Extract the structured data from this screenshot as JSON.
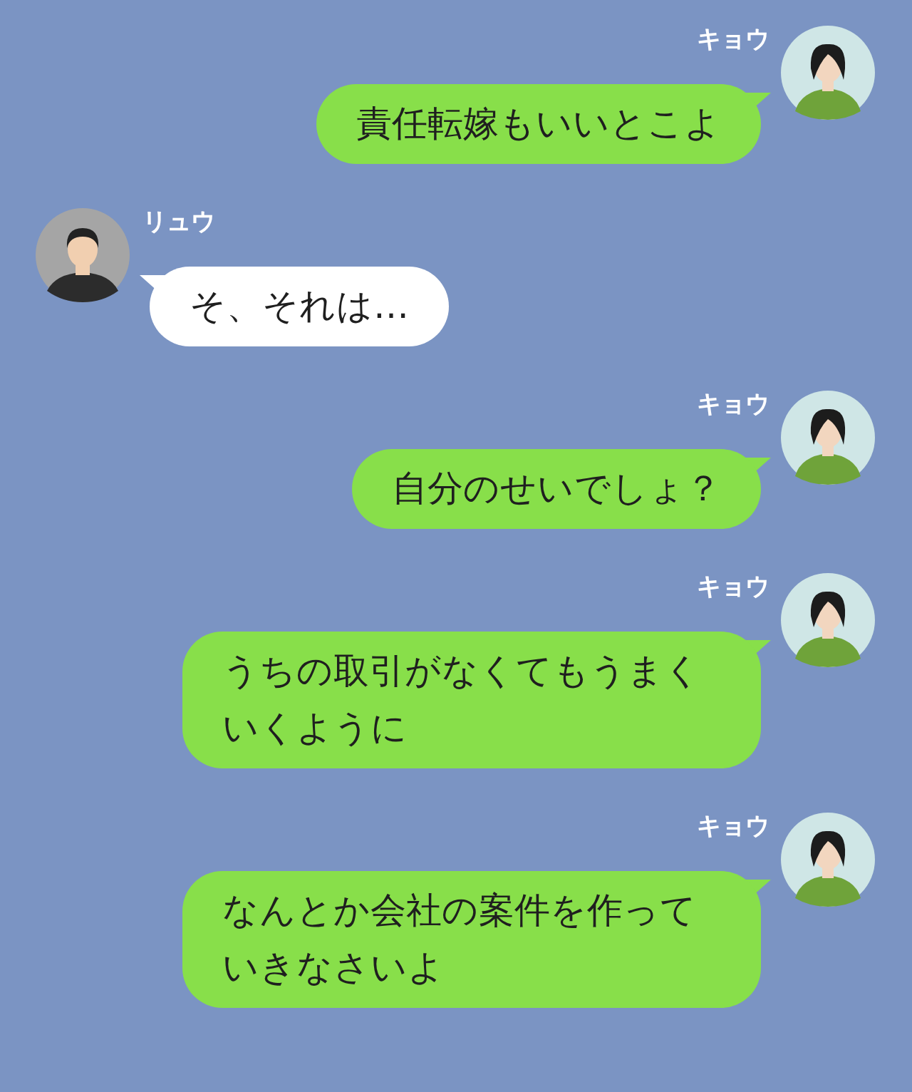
{
  "messages": [
    {
      "kind": "sent",
      "sender": "キョウ",
      "text": "責任転嫁もいいとこよ"
    },
    {
      "kind": "received",
      "sender": "リュウ",
      "text": "そ、それは…"
    },
    {
      "kind": "sent",
      "sender": "キョウ",
      "text": "自分のせいでしょ？"
    },
    {
      "kind": "sent",
      "sender": "キョウ",
      "text": "うちの取引がなくてもうまくいくように"
    },
    {
      "kind": "sent",
      "sender": "キョウ",
      "text": "なんとか会社の案件を作っていきなさいよ"
    }
  ]
}
